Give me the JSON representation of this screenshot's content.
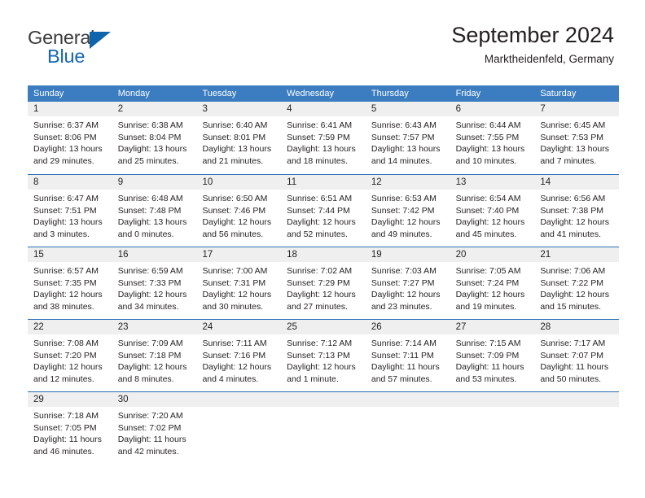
{
  "brand": {
    "logo_primary": "General",
    "logo_secondary": "Blue",
    "triangle_icon": "blue-triangle-icon"
  },
  "header": {
    "title": "September 2024",
    "subtitle": "Marktheidenfeld, Germany"
  },
  "colors": {
    "header_blue": "#3b7dc0",
    "rule_blue": "#2a6db5",
    "logo_blue": "#1567b3",
    "day_band_gray": "#efefef",
    "text": "#231f20"
  },
  "weekdays": [
    "Sunday",
    "Monday",
    "Tuesday",
    "Wednesday",
    "Thursday",
    "Friday",
    "Saturday"
  ],
  "weeks": [
    [
      {
        "day": "1",
        "sunrise": "Sunrise: 6:37 AM",
        "sunset": "Sunset: 8:06 PM",
        "daylight1": "Daylight: 13 hours",
        "daylight2": "and 29 minutes."
      },
      {
        "day": "2",
        "sunrise": "Sunrise: 6:38 AM",
        "sunset": "Sunset: 8:04 PM",
        "daylight1": "Daylight: 13 hours",
        "daylight2": "and 25 minutes."
      },
      {
        "day": "3",
        "sunrise": "Sunrise: 6:40 AM",
        "sunset": "Sunset: 8:01 PM",
        "daylight1": "Daylight: 13 hours",
        "daylight2": "and 21 minutes."
      },
      {
        "day": "4",
        "sunrise": "Sunrise: 6:41 AM",
        "sunset": "Sunset: 7:59 PM",
        "daylight1": "Daylight: 13 hours",
        "daylight2": "and 18 minutes."
      },
      {
        "day": "5",
        "sunrise": "Sunrise: 6:43 AM",
        "sunset": "Sunset: 7:57 PM",
        "daylight1": "Daylight: 13 hours",
        "daylight2": "and 14 minutes."
      },
      {
        "day": "6",
        "sunrise": "Sunrise: 6:44 AM",
        "sunset": "Sunset: 7:55 PM",
        "daylight1": "Daylight: 13 hours",
        "daylight2": "and 10 minutes."
      },
      {
        "day": "7",
        "sunrise": "Sunrise: 6:45 AM",
        "sunset": "Sunset: 7:53 PM",
        "daylight1": "Daylight: 13 hours",
        "daylight2": "and 7 minutes."
      }
    ],
    [
      {
        "day": "8",
        "sunrise": "Sunrise: 6:47 AM",
        "sunset": "Sunset: 7:51 PM",
        "daylight1": "Daylight: 13 hours",
        "daylight2": "and 3 minutes."
      },
      {
        "day": "9",
        "sunrise": "Sunrise: 6:48 AM",
        "sunset": "Sunset: 7:48 PM",
        "daylight1": "Daylight: 13 hours",
        "daylight2": "and 0 minutes."
      },
      {
        "day": "10",
        "sunrise": "Sunrise: 6:50 AM",
        "sunset": "Sunset: 7:46 PM",
        "daylight1": "Daylight: 12 hours",
        "daylight2": "and 56 minutes."
      },
      {
        "day": "11",
        "sunrise": "Sunrise: 6:51 AM",
        "sunset": "Sunset: 7:44 PM",
        "daylight1": "Daylight: 12 hours",
        "daylight2": "and 52 minutes."
      },
      {
        "day": "12",
        "sunrise": "Sunrise: 6:53 AM",
        "sunset": "Sunset: 7:42 PM",
        "daylight1": "Daylight: 12 hours",
        "daylight2": "and 49 minutes."
      },
      {
        "day": "13",
        "sunrise": "Sunrise: 6:54 AM",
        "sunset": "Sunset: 7:40 PM",
        "daylight1": "Daylight: 12 hours",
        "daylight2": "and 45 minutes."
      },
      {
        "day": "14",
        "sunrise": "Sunrise: 6:56 AM",
        "sunset": "Sunset: 7:38 PM",
        "daylight1": "Daylight: 12 hours",
        "daylight2": "and 41 minutes."
      }
    ],
    [
      {
        "day": "15",
        "sunrise": "Sunrise: 6:57 AM",
        "sunset": "Sunset: 7:35 PM",
        "daylight1": "Daylight: 12 hours",
        "daylight2": "and 38 minutes."
      },
      {
        "day": "16",
        "sunrise": "Sunrise: 6:59 AM",
        "sunset": "Sunset: 7:33 PM",
        "daylight1": "Daylight: 12 hours",
        "daylight2": "and 34 minutes."
      },
      {
        "day": "17",
        "sunrise": "Sunrise: 7:00 AM",
        "sunset": "Sunset: 7:31 PM",
        "daylight1": "Daylight: 12 hours",
        "daylight2": "and 30 minutes."
      },
      {
        "day": "18",
        "sunrise": "Sunrise: 7:02 AM",
        "sunset": "Sunset: 7:29 PM",
        "daylight1": "Daylight: 12 hours",
        "daylight2": "and 27 minutes."
      },
      {
        "day": "19",
        "sunrise": "Sunrise: 7:03 AM",
        "sunset": "Sunset: 7:27 PM",
        "daylight1": "Daylight: 12 hours",
        "daylight2": "and 23 minutes."
      },
      {
        "day": "20",
        "sunrise": "Sunrise: 7:05 AM",
        "sunset": "Sunset: 7:24 PM",
        "daylight1": "Daylight: 12 hours",
        "daylight2": "and 19 minutes."
      },
      {
        "day": "21",
        "sunrise": "Sunrise: 7:06 AM",
        "sunset": "Sunset: 7:22 PM",
        "daylight1": "Daylight: 12 hours",
        "daylight2": "and 15 minutes."
      }
    ],
    [
      {
        "day": "22",
        "sunrise": "Sunrise: 7:08 AM",
        "sunset": "Sunset: 7:20 PM",
        "daylight1": "Daylight: 12 hours",
        "daylight2": "and 12 minutes."
      },
      {
        "day": "23",
        "sunrise": "Sunrise: 7:09 AM",
        "sunset": "Sunset: 7:18 PM",
        "daylight1": "Daylight: 12 hours",
        "daylight2": "and 8 minutes."
      },
      {
        "day": "24",
        "sunrise": "Sunrise: 7:11 AM",
        "sunset": "Sunset: 7:16 PM",
        "daylight1": "Daylight: 12 hours",
        "daylight2": "and 4 minutes."
      },
      {
        "day": "25",
        "sunrise": "Sunrise: 7:12 AM",
        "sunset": "Sunset: 7:13 PM",
        "daylight1": "Daylight: 12 hours",
        "daylight2": "and 1 minute."
      },
      {
        "day": "26",
        "sunrise": "Sunrise: 7:14 AM",
        "sunset": "Sunset: 7:11 PM",
        "daylight1": "Daylight: 11 hours",
        "daylight2": "and 57 minutes."
      },
      {
        "day": "27",
        "sunrise": "Sunrise: 7:15 AM",
        "sunset": "Sunset: 7:09 PM",
        "daylight1": "Daylight: 11 hours",
        "daylight2": "and 53 minutes."
      },
      {
        "day": "28",
        "sunrise": "Sunrise: 7:17 AM",
        "sunset": "Sunset: 7:07 PM",
        "daylight1": "Daylight: 11 hours",
        "daylight2": "and 50 minutes."
      }
    ],
    [
      {
        "day": "29",
        "sunrise": "Sunrise: 7:18 AM",
        "sunset": "Sunset: 7:05 PM",
        "daylight1": "Daylight: 11 hours",
        "daylight2": "and 46 minutes."
      },
      {
        "day": "30",
        "sunrise": "Sunrise: 7:20 AM",
        "sunset": "Sunset: 7:02 PM",
        "daylight1": "Daylight: 11 hours",
        "daylight2": "and 42 minutes."
      },
      {
        "day": "",
        "sunrise": "",
        "sunset": "",
        "daylight1": "",
        "daylight2": ""
      },
      {
        "day": "",
        "sunrise": "",
        "sunset": "",
        "daylight1": "",
        "daylight2": ""
      },
      {
        "day": "",
        "sunrise": "",
        "sunset": "",
        "daylight1": "",
        "daylight2": ""
      },
      {
        "day": "",
        "sunrise": "",
        "sunset": "",
        "daylight1": "",
        "daylight2": ""
      },
      {
        "day": "",
        "sunrise": "",
        "sunset": "",
        "daylight1": "",
        "daylight2": ""
      }
    ]
  ]
}
